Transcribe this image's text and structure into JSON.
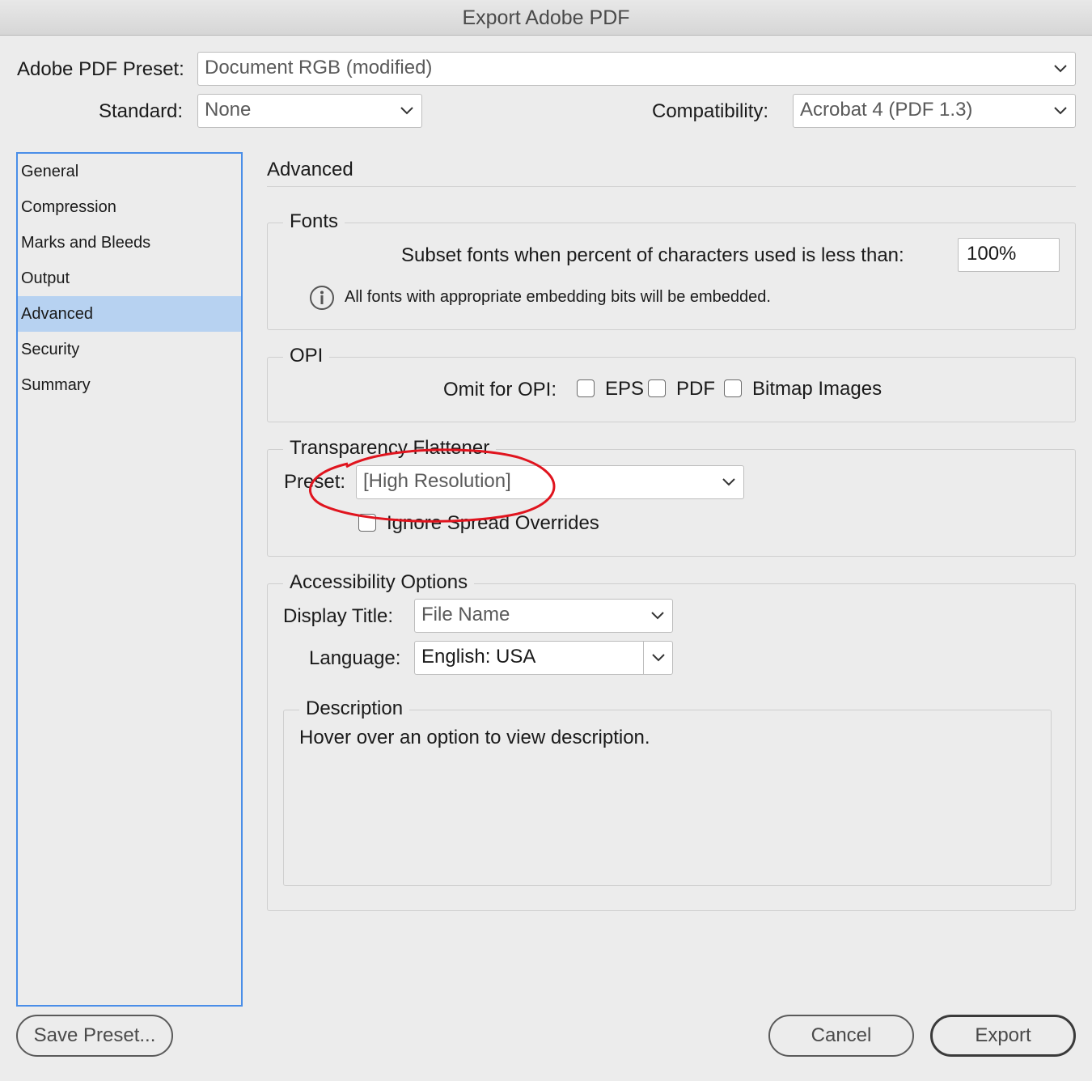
{
  "window": {
    "title": "Export Adobe PDF"
  },
  "preset": {
    "label": "Adobe PDF Preset:",
    "value": "Document RGB (modified)"
  },
  "standard": {
    "label": "Standard:",
    "value": "None"
  },
  "compatibility": {
    "label": "Compatibility:",
    "value": "Acrobat 4 (PDF 1.3)"
  },
  "sidebar": {
    "items": [
      {
        "label": "General"
      },
      {
        "label": "Compression"
      },
      {
        "label": "Marks and Bleeds"
      },
      {
        "label": "Output"
      },
      {
        "label": "Advanced",
        "selected": true
      },
      {
        "label": "Security"
      },
      {
        "label": "Summary"
      }
    ]
  },
  "main": {
    "heading": "Advanced"
  },
  "fonts": {
    "legend": "Fonts",
    "subset_label": "Subset fonts when percent of characters used is less than:",
    "subset_value": "100%",
    "info_text": "All fonts with appropriate embedding bits will be embedded."
  },
  "opi": {
    "legend": "OPI",
    "omit_label": "Omit for OPI:",
    "eps_label": "EPS",
    "pdf_label": "PDF",
    "bitmap_label": "Bitmap Images"
  },
  "flattener": {
    "legend": "Transparency Flattener",
    "preset_label": "Preset:",
    "preset_value": "[High Resolution]",
    "ignore_label": "Ignore Spread Overrides"
  },
  "accessibility": {
    "legend": "Accessibility Options",
    "display_title_label": "Display Title:",
    "display_title_value": "File Name",
    "language_label": "Language:",
    "language_value": "English: USA"
  },
  "description": {
    "legend": "Description",
    "text": "Hover over an option to view description."
  },
  "buttons": {
    "save_preset": "Save Preset...",
    "cancel": "Cancel",
    "export": "Export"
  },
  "colors": {
    "selection": "#b7d2f1",
    "focus_ring": "#4a8ee8",
    "annotation": "#e0141e"
  },
  "icons": {
    "dropdown": "chevron-down-icon",
    "info": "info-icon"
  }
}
